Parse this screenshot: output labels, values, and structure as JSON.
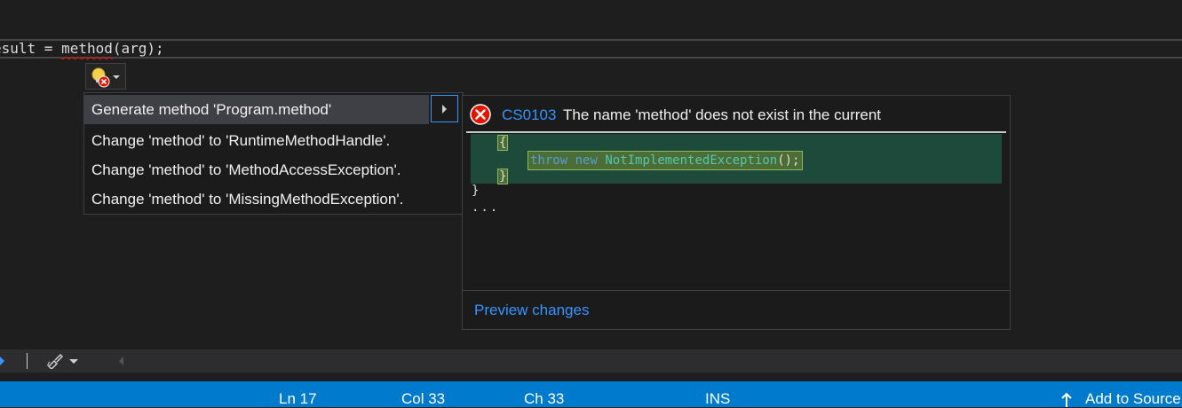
{
  "editor": {
    "code": {
      "prefix": "esult = ",
      "method": "method",
      "suffix": "(arg);"
    }
  },
  "quick_actions": {
    "items": [
      {
        "label": "Generate method 'Program.method'"
      },
      {
        "label": "Change 'method' to 'RuntimeMethodHandle'."
      },
      {
        "label": "Change 'method' to 'MethodAccessException'."
      },
      {
        "label": "Change 'method' to 'MissingMethodException'."
      }
    ]
  },
  "preview": {
    "error_code": "CS0103",
    "error_message": "The name 'method' does not exist in the current",
    "code": {
      "open_brace": "{",
      "throw_kw": "throw",
      "new_kw": "new",
      "exception_type": "NotImplementedException",
      "call_suffix": "();",
      "close_brace": "}",
      "outer_close": "}",
      "ellipsis": "..."
    },
    "link": "Preview changes"
  },
  "status_bar": {
    "line": "Ln 17",
    "col": "Col 33",
    "ch": "Ch 33",
    "mode": "INS",
    "source_control": "Add to Source"
  },
  "colors": {
    "status_bar": "#007acc",
    "link": "#3794ff",
    "error": "#e51400",
    "diff_background": "#1e4a3c"
  }
}
